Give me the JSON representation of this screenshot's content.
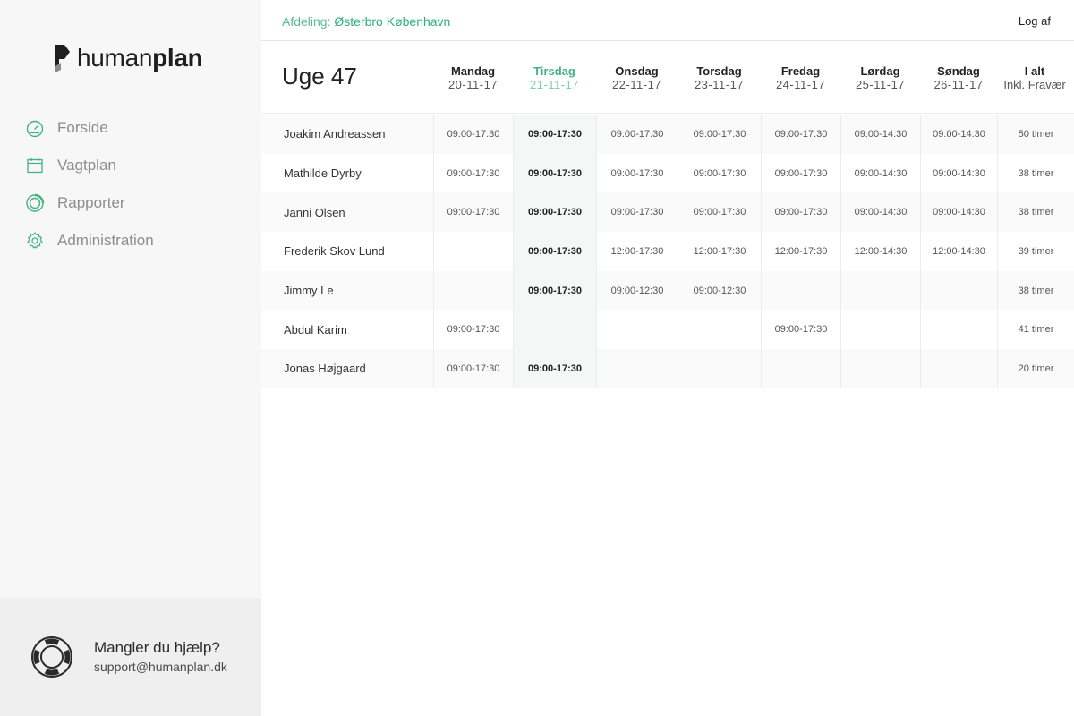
{
  "brand": {
    "name_light": "human",
    "name_bold": "plan"
  },
  "nav": {
    "items": [
      {
        "label": "Forside",
        "icon": "dashboard-gauge-icon"
      },
      {
        "label": "Vagtplan",
        "icon": "calendar-icon"
      },
      {
        "label": "Rapporter",
        "icon": "reports-circle-icon"
      },
      {
        "label": "Administration",
        "icon": "gear-icon"
      }
    ]
  },
  "help": {
    "title": "Mangler du hjælp?",
    "email": "support@humanplan.dk",
    "icon": "lifebuoy-icon"
  },
  "topbar": {
    "department_label": "Afdeling:",
    "department_value": "Østerbro København",
    "logout_label": "Log af"
  },
  "colors": {
    "accent": "#43b187",
    "sidebar_bg": "#f7f7f7",
    "today_bg": "#f3f8f6"
  },
  "schedule": {
    "week_title": "Uge 47",
    "days": [
      {
        "name": "Mandag",
        "date": "20-11-17",
        "today": false
      },
      {
        "name": "Tirsdag",
        "date": "21-11-17",
        "today": true
      },
      {
        "name": "Onsdag",
        "date": "22-11-17",
        "today": false
      },
      {
        "name": "Torsdag",
        "date": "23-11-17",
        "today": false
      },
      {
        "name": "Fredag",
        "date": "24-11-17",
        "today": false
      },
      {
        "name": "Lørdag",
        "date": "25-11-17",
        "today": false
      },
      {
        "name": "Søndag",
        "date": "26-11-17",
        "today": false
      }
    ],
    "total_header": {
      "name": "I alt",
      "sub": "Inkl. Fravær"
    },
    "rows": [
      {
        "name": "Joakim Andreassen",
        "shifts": [
          "09:00-17:30",
          "09:00-17:30",
          "09:00-17:30",
          "09:00-17:30",
          "09:00-17:30",
          "09:00-14:30",
          "09:00-14:30"
        ],
        "total": "50 timer"
      },
      {
        "name": "Mathilde Dyrby",
        "shifts": [
          "09:00-17:30",
          "09:00-17:30",
          "09:00-17:30",
          "09:00-17:30",
          "09:00-17:30",
          "09:00-14:30",
          "09:00-14:30"
        ],
        "total": "38 timer"
      },
      {
        "name": "Janni Olsen",
        "shifts": [
          "09:00-17:30",
          "09:00-17:30",
          "09:00-17:30",
          "09:00-17:30",
          "09:00-17:30",
          "09:00-14:30",
          "09:00-14:30"
        ],
        "total": "38 timer"
      },
      {
        "name": "Frederik Skov Lund",
        "shifts": [
          "",
          "09:00-17:30",
          "12:00-17:30",
          "12:00-17:30",
          "12:00-17:30",
          "12:00-14:30",
          "12:00-14:30"
        ],
        "total": "39 timer"
      },
      {
        "name": "Jimmy Le",
        "shifts": [
          "",
          "09:00-17:30",
          "09:00-12:30",
          "09:00-12:30",
          "",
          "",
          ""
        ],
        "total": "38 timer"
      },
      {
        "name": "Abdul Karim",
        "shifts": [
          "09:00-17:30",
          "",
          "",
          "",
          "09:00-17:30",
          "",
          ""
        ],
        "total": "41 timer"
      },
      {
        "name": "Jonas Højgaard",
        "shifts": [
          "09:00-17:30",
          "09:00-17:30",
          "",
          "",
          "",
          "",
          ""
        ],
        "total": "20 timer"
      }
    ]
  }
}
